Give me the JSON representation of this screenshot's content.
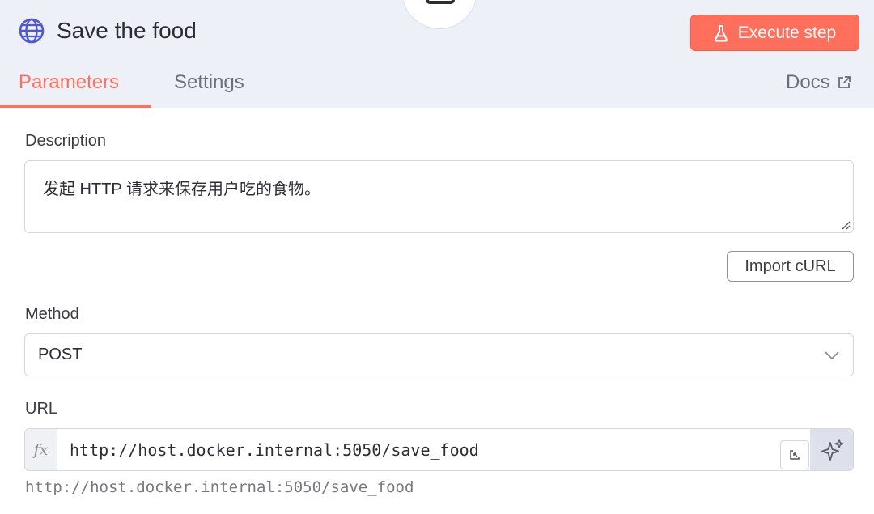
{
  "header": {
    "title": "Save the food",
    "node_icon": "globe-icon",
    "execute_label": "Execute step",
    "accent_color": "#ff6f5c"
  },
  "tabs": [
    {
      "label": "Parameters",
      "active": true
    },
    {
      "label": "Settings",
      "active": false
    }
  ],
  "docs_label": "Docs",
  "description": {
    "label": "Description",
    "value": "发起 HTTP 请求来保存用户吃的食物。"
  },
  "import_curl_label": "Import cURL",
  "method": {
    "label": "Method",
    "value": "POST"
  },
  "url": {
    "label": "URL",
    "fx_label": "fx",
    "value": "http://host.docker.internal:5050/save_food",
    "preview": "http://host.docker.internal:5050/save_food"
  }
}
